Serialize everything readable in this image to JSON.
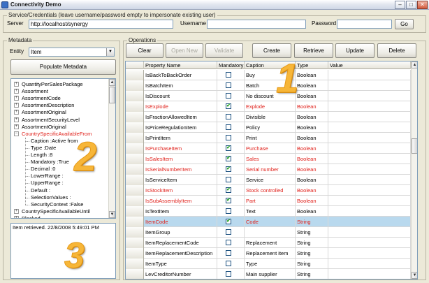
{
  "window": {
    "title": "Connectivity Demo",
    "minimize": "–",
    "maximize": "□",
    "close": "✕"
  },
  "credentials": {
    "legend": "Service/Credentials (leave username/password empty to impersonate existing user)",
    "server_label": "Server",
    "server_value": "http://localhost/synergy",
    "username_label": "Username",
    "username_value": "",
    "password_label": "Password",
    "password_value": "",
    "go_label": "Go"
  },
  "metadata": {
    "legend": "Metadata",
    "entity_label": "Entity",
    "entity_value": "Item",
    "populate_label": "Populate Metadata",
    "tree": [
      {
        "text": "QuantityPerSalesPackage",
        "level": 0,
        "expander": "+",
        "red": false
      },
      {
        "text": "Assortment",
        "level": 0,
        "expander": "+",
        "red": false
      },
      {
        "text": "AssortmentCode",
        "level": 0,
        "expander": "+",
        "red": false
      },
      {
        "text": "AssortmentDescription",
        "level": 0,
        "expander": "+",
        "red": false
      },
      {
        "text": "AssortmentOriginal",
        "level": 0,
        "expander": "+",
        "red": false
      },
      {
        "text": "AssortmentSecurityLevel",
        "level": 0,
        "expander": "+",
        "red": false
      },
      {
        "text": "AssortmentOriginal",
        "level": 0,
        "expander": "+",
        "red": false
      },
      {
        "text": "CountrySpecificAvailableFrom",
        "level": 0,
        "expander": "−",
        "red": true
      },
      {
        "text": "Caption :Active from",
        "level": 1,
        "expander": "",
        "red": false
      },
      {
        "text": "Type :Date",
        "level": 1,
        "expander": "",
        "red": false
      },
      {
        "text": "Length :8",
        "level": 1,
        "expander": "",
        "red": false
      },
      {
        "text": "Mandatory :True",
        "level": 1,
        "expander": "",
        "red": false
      },
      {
        "text": "Decimal :0",
        "level": 1,
        "expander": "",
        "red": false
      },
      {
        "text": "LowerRange :",
        "level": 1,
        "expander": "",
        "red": false
      },
      {
        "text": "UpperRange :",
        "level": 1,
        "expander": "",
        "red": false
      },
      {
        "text": "Default :",
        "level": 1,
        "expander": "",
        "red": false
      },
      {
        "text": "SelectionValues :",
        "level": 1,
        "expander": "",
        "red": false
      },
      {
        "text": "SecurityContext :False",
        "level": 1,
        "expander": "",
        "red": false
      },
      {
        "text": "CountrySpecificAvailableUntil",
        "level": 0,
        "expander": "+",
        "red": false
      },
      {
        "text": "Blocked",
        "level": 0,
        "expander": "+",
        "red": false
      }
    ],
    "log_text": "Item retrieved. 22/8/2008 5:49:01 PM"
  },
  "operations": {
    "legend": "Operations",
    "buttons": [
      {
        "label": "Clear",
        "enabled": true
      },
      {
        "label": "Open New",
        "enabled": false
      },
      {
        "label": "Validate",
        "enabled": false
      },
      {
        "label": "Create",
        "enabled": true
      },
      {
        "label": "Retrieve",
        "enabled": true
      },
      {
        "label": "Update",
        "enabled": true
      },
      {
        "label": "Delete",
        "enabled": true
      }
    ],
    "columns": [
      "Property Name",
      "Mandatory",
      "Caption",
      "Type",
      "Value"
    ],
    "rows": [
      {
        "name": "IsBackToBackOrder",
        "mandatory": false,
        "caption": "Buy",
        "type": "Boolean",
        "red": false,
        "selected": false
      },
      {
        "name": "IsBatchItem",
        "mandatory": false,
        "caption": "Batch",
        "type": "Boolean",
        "red": false,
        "selected": false
      },
      {
        "name": "IsDiscount",
        "mandatory": false,
        "caption": "No discount",
        "type": "Boolean",
        "red": false,
        "selected": false
      },
      {
        "name": "IsExplode",
        "mandatory": true,
        "caption": "Explode",
        "type": "Boolean",
        "red": true,
        "selected": false
      },
      {
        "name": "IsFractionAllowedItem",
        "mandatory": false,
        "caption": "Divisible",
        "type": "Boolean",
        "red": false,
        "selected": false
      },
      {
        "name": "IsPriceRegulationItem",
        "mandatory": false,
        "caption": "Policy",
        "type": "Boolean",
        "red": false,
        "selected": false
      },
      {
        "name": "IsPrintItem",
        "mandatory": false,
        "caption": "Print",
        "type": "Boolean",
        "red": false,
        "selected": false
      },
      {
        "name": "IsPurchaseItem",
        "mandatory": true,
        "caption": "Purchase",
        "type": "Boolean",
        "red": true,
        "selected": false
      },
      {
        "name": "IsSalesItem",
        "mandatory": true,
        "caption": "Sales",
        "type": "Boolean",
        "red": true,
        "selected": false
      },
      {
        "name": "IsSerialNumberItem",
        "mandatory": true,
        "caption": "Serial number",
        "type": "Boolean",
        "red": true,
        "selected": false
      },
      {
        "name": "IsServiceItem",
        "mandatory": false,
        "caption": "Service",
        "type": "Boolean",
        "red": false,
        "selected": false
      },
      {
        "name": "IsStockItem",
        "mandatory": true,
        "caption": "Stock controlled",
        "type": "Boolean",
        "red": true,
        "selected": false
      },
      {
        "name": "IsSubAssemblyItem",
        "mandatory": true,
        "caption": "Part",
        "type": "Boolean",
        "red": true,
        "selected": false
      },
      {
        "name": "IsTextItem",
        "mandatory": false,
        "caption": "Text",
        "type": "Boolean",
        "red": false,
        "selected": false
      },
      {
        "name": "ItemCode",
        "mandatory": true,
        "caption": "Code",
        "type": "String",
        "red": true,
        "selected": true
      },
      {
        "name": "ItemGroup",
        "mandatory": false,
        "caption": "",
        "type": "String",
        "red": false,
        "selected": false
      },
      {
        "name": "ItemReplacementCode",
        "mandatory": false,
        "caption": "Replacement",
        "type": "String",
        "red": false,
        "selected": false
      },
      {
        "name": "ItemReplacementDescription",
        "mandatory": false,
        "caption": "Replacement item",
        "type": "String",
        "red": false,
        "selected": false
      },
      {
        "name": "ItemType",
        "mandatory": false,
        "caption": "Type",
        "type": "String",
        "red": false,
        "selected": false
      },
      {
        "name": "LevCreditorNumber",
        "mandatory": false,
        "caption": "Main supplier",
        "type": "String",
        "red": false,
        "selected": false
      }
    ]
  },
  "annotations": {
    "one": "1",
    "two": "2",
    "three": "3"
  },
  "colors": {
    "required": "#e0201a",
    "selected_row": "#b9d9ee",
    "annotation": "#f7b638"
  }
}
